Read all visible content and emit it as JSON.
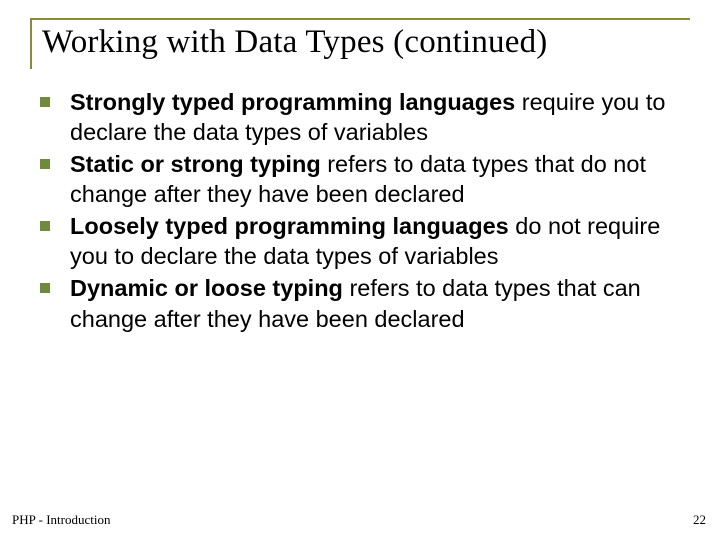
{
  "title": "Working with Data Types (continued)",
  "bullets": [
    {
      "bold": "Strongly typed programming languages",
      "rest": " require you to declare the data types of variables"
    },
    {
      "bold": "Static or strong typing",
      "rest": " refers to data types that do not change after they have been declared"
    },
    {
      "bold": "Loosely typed programming languages",
      "rest": " do not require you to declare the data types of variables"
    },
    {
      "bold": "Dynamic or loose typing",
      "rest": " refers to data types that can change after they have been declared"
    }
  ],
  "footer_left": "PHP - Introduction",
  "footer_right": "22"
}
